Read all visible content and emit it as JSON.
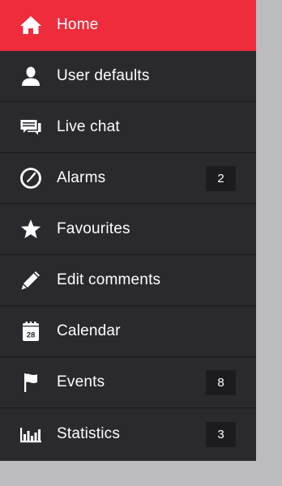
{
  "menu": {
    "items": [
      {
        "label": "Home",
        "icon": "home-icon",
        "badge": "",
        "active": true
      },
      {
        "label": "User defaults",
        "icon": "user-icon",
        "badge": ""
      },
      {
        "label": "Live chat",
        "icon": "chat-icon",
        "badge": ""
      },
      {
        "label": "Alarms",
        "icon": "clock-icon",
        "badge": "2"
      },
      {
        "label": "Favourites",
        "icon": "star-icon",
        "badge": ""
      },
      {
        "label": "Edit comments",
        "icon": "pencil-icon",
        "badge": ""
      },
      {
        "label": "Calendar",
        "icon": "calendar-icon",
        "badge": "",
        "icon_text": "28"
      },
      {
        "label": "Events",
        "icon": "flag-icon",
        "badge": "8"
      },
      {
        "label": "Statistics",
        "icon": "bar-chart-icon",
        "badge": "3"
      }
    ]
  },
  "colors": {
    "active_bg": "#ee2c3c",
    "menu_bg": "#2a2a2e",
    "badge_bg": "#1c1c1f",
    "page_bg": "#bcbcc0"
  }
}
